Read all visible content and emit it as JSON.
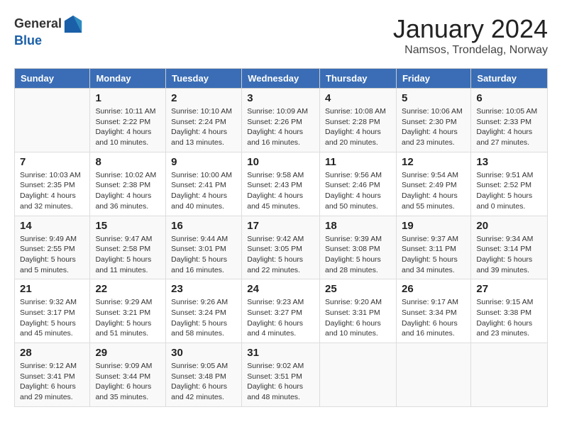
{
  "logo": {
    "general": "General",
    "blue": "Blue"
  },
  "title": "January 2024",
  "location": "Namsos, Trondelag, Norway",
  "weekdays": [
    "Sunday",
    "Monday",
    "Tuesday",
    "Wednesday",
    "Thursday",
    "Friday",
    "Saturday"
  ],
  "weeks": [
    [
      {
        "num": "",
        "info": ""
      },
      {
        "num": "1",
        "info": "Sunrise: 10:11 AM\nSunset: 2:22 PM\nDaylight: 4 hours\nand 10 minutes."
      },
      {
        "num": "2",
        "info": "Sunrise: 10:10 AM\nSunset: 2:24 PM\nDaylight: 4 hours\nand 13 minutes."
      },
      {
        "num": "3",
        "info": "Sunrise: 10:09 AM\nSunset: 2:26 PM\nDaylight: 4 hours\nand 16 minutes."
      },
      {
        "num": "4",
        "info": "Sunrise: 10:08 AM\nSunset: 2:28 PM\nDaylight: 4 hours\nand 20 minutes."
      },
      {
        "num": "5",
        "info": "Sunrise: 10:06 AM\nSunset: 2:30 PM\nDaylight: 4 hours\nand 23 minutes."
      },
      {
        "num": "6",
        "info": "Sunrise: 10:05 AM\nSunset: 2:33 PM\nDaylight: 4 hours\nand 27 minutes."
      }
    ],
    [
      {
        "num": "7",
        "info": "Sunrise: 10:03 AM\nSunset: 2:35 PM\nDaylight: 4 hours\nand 32 minutes."
      },
      {
        "num": "8",
        "info": "Sunrise: 10:02 AM\nSunset: 2:38 PM\nDaylight: 4 hours\nand 36 minutes."
      },
      {
        "num": "9",
        "info": "Sunrise: 10:00 AM\nSunset: 2:41 PM\nDaylight: 4 hours\nand 40 minutes."
      },
      {
        "num": "10",
        "info": "Sunrise: 9:58 AM\nSunset: 2:43 PM\nDaylight: 4 hours\nand 45 minutes."
      },
      {
        "num": "11",
        "info": "Sunrise: 9:56 AM\nSunset: 2:46 PM\nDaylight: 4 hours\nand 50 minutes."
      },
      {
        "num": "12",
        "info": "Sunrise: 9:54 AM\nSunset: 2:49 PM\nDaylight: 4 hours\nand 55 minutes."
      },
      {
        "num": "13",
        "info": "Sunrise: 9:51 AM\nSunset: 2:52 PM\nDaylight: 5 hours\nand 0 minutes."
      }
    ],
    [
      {
        "num": "14",
        "info": "Sunrise: 9:49 AM\nSunset: 2:55 PM\nDaylight: 5 hours\nand 5 minutes."
      },
      {
        "num": "15",
        "info": "Sunrise: 9:47 AM\nSunset: 2:58 PM\nDaylight: 5 hours\nand 11 minutes."
      },
      {
        "num": "16",
        "info": "Sunrise: 9:44 AM\nSunset: 3:01 PM\nDaylight: 5 hours\nand 16 minutes."
      },
      {
        "num": "17",
        "info": "Sunrise: 9:42 AM\nSunset: 3:05 PM\nDaylight: 5 hours\nand 22 minutes."
      },
      {
        "num": "18",
        "info": "Sunrise: 9:39 AM\nSunset: 3:08 PM\nDaylight: 5 hours\nand 28 minutes."
      },
      {
        "num": "19",
        "info": "Sunrise: 9:37 AM\nSunset: 3:11 PM\nDaylight: 5 hours\nand 34 minutes."
      },
      {
        "num": "20",
        "info": "Sunrise: 9:34 AM\nSunset: 3:14 PM\nDaylight: 5 hours\nand 39 minutes."
      }
    ],
    [
      {
        "num": "21",
        "info": "Sunrise: 9:32 AM\nSunset: 3:17 PM\nDaylight: 5 hours\nand 45 minutes."
      },
      {
        "num": "22",
        "info": "Sunrise: 9:29 AM\nSunset: 3:21 PM\nDaylight: 5 hours\nand 51 minutes."
      },
      {
        "num": "23",
        "info": "Sunrise: 9:26 AM\nSunset: 3:24 PM\nDaylight: 5 hours\nand 58 minutes."
      },
      {
        "num": "24",
        "info": "Sunrise: 9:23 AM\nSunset: 3:27 PM\nDaylight: 6 hours\nand 4 minutes."
      },
      {
        "num": "25",
        "info": "Sunrise: 9:20 AM\nSunset: 3:31 PM\nDaylight: 6 hours\nand 10 minutes."
      },
      {
        "num": "26",
        "info": "Sunrise: 9:17 AM\nSunset: 3:34 PM\nDaylight: 6 hours\nand 16 minutes."
      },
      {
        "num": "27",
        "info": "Sunrise: 9:15 AM\nSunset: 3:38 PM\nDaylight: 6 hours\nand 23 minutes."
      }
    ],
    [
      {
        "num": "28",
        "info": "Sunrise: 9:12 AM\nSunset: 3:41 PM\nDaylight: 6 hours\nand 29 minutes."
      },
      {
        "num": "29",
        "info": "Sunrise: 9:09 AM\nSunset: 3:44 PM\nDaylight: 6 hours\nand 35 minutes."
      },
      {
        "num": "30",
        "info": "Sunrise: 9:05 AM\nSunset: 3:48 PM\nDaylight: 6 hours\nand 42 minutes."
      },
      {
        "num": "31",
        "info": "Sunrise: 9:02 AM\nSunset: 3:51 PM\nDaylight: 6 hours\nand 48 minutes."
      },
      {
        "num": "",
        "info": ""
      },
      {
        "num": "",
        "info": ""
      },
      {
        "num": "",
        "info": ""
      }
    ]
  ]
}
